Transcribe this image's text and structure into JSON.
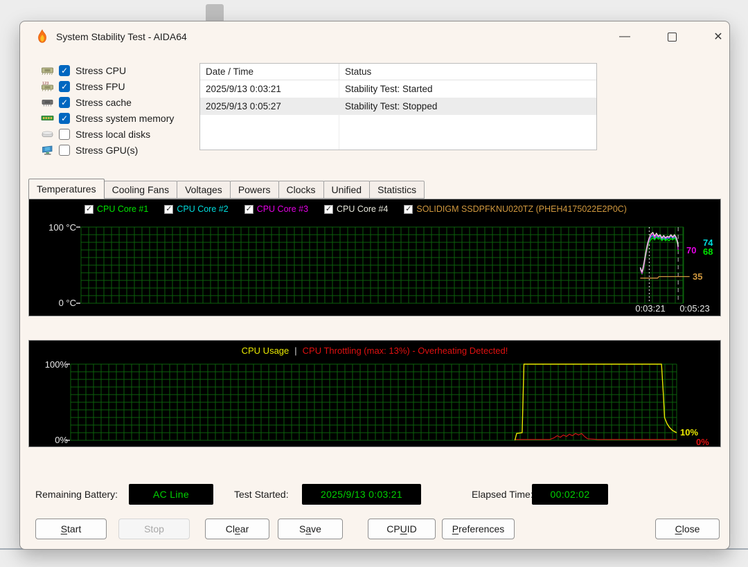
{
  "window": {
    "title": "System Stability Test - AIDA64",
    "controls": {
      "minimize": "—",
      "close": "✕"
    }
  },
  "stress_options": [
    {
      "label": "Stress CPU",
      "checked": true,
      "icon": "cpu-icon"
    },
    {
      "label": "Stress FPU",
      "checked": true,
      "icon": "fpu-icon"
    },
    {
      "label": "Stress cache",
      "checked": true,
      "icon": "cache-icon"
    },
    {
      "label": "Stress system memory",
      "checked": true,
      "icon": "memory-icon"
    },
    {
      "label": "Stress local disks",
      "checked": false,
      "icon": "disk-icon"
    },
    {
      "label": "Stress GPU(s)",
      "checked": false,
      "icon": "gpu-icon"
    }
  ],
  "log_table": {
    "columns": [
      "Date / Time",
      "Status"
    ],
    "rows": [
      {
        "datetime": "2025/9/13 0:03:21",
        "status": "Stability Test: Started",
        "selected": false
      },
      {
        "datetime": "2025/9/13 0:05:27",
        "status": "Stability Test: Stopped",
        "selected": true
      }
    ],
    "empty_row_count": 2
  },
  "tabs": [
    {
      "label": "Temperatures",
      "active": true
    },
    {
      "label": "Cooling Fans",
      "active": false
    },
    {
      "label": "Voltages",
      "active": false
    },
    {
      "label": "Powers",
      "active": false
    },
    {
      "label": "Clocks",
      "active": false
    },
    {
      "label": "Unified",
      "active": false
    },
    {
      "label": "Statistics",
      "active": false
    }
  ],
  "chart_data": [
    {
      "type": "line",
      "panel": "temperatures",
      "ymax": 100,
      "ylabel_top": "100 °C",
      "ylabel_bottom": "0 °C",
      "x_tick_start": "0:03:21",
      "x_tick_end": "0:05:23",
      "grid": "green mesh on black",
      "legend": [
        {
          "label": "CPU Core #1",
          "color": "#00e400",
          "checked": true
        },
        {
          "label": "CPU Core #2",
          "color": "#00dcdc",
          "checked": true
        },
        {
          "label": "CPU Core #3",
          "color": "#e400e4",
          "checked": true
        },
        {
          "label": "CPU Core #4",
          "color": "#e8e8dc",
          "checked": true
        },
        {
          "label": "SOLIDIGM SSDPFKNU020TZ (PHEH4175022E2P0C)",
          "color": "#d0983e",
          "checked": true
        }
      ],
      "end_labels": [
        {
          "text": "70",
          "color": "#e400e4"
        },
        {
          "text": "74",
          "color": "#00dcdc"
        },
        {
          "text": "68",
          "color": "#00e400"
        },
        {
          "text": "35",
          "color": "#d0983e"
        }
      ],
      "markers": {
        "test_start_x": 0.943,
        "test_end_x": 0.991
      },
      "series": [
        {
          "name": "CPU Core #4",
          "color": "#e8e8dc",
          "points": [
            [
              0.928,
              47
            ],
            [
              0.931,
              41
            ],
            [
              0.934,
              52
            ],
            [
              0.937,
              66
            ],
            [
              0.94,
              78
            ],
            [
              0.943,
              86
            ],
            [
              0.946,
              91
            ],
            [
              0.949,
              93
            ],
            [
              0.952,
              88
            ],
            [
              0.955,
              92
            ],
            [
              0.958,
              88
            ],
            [
              0.961,
              90
            ],
            [
              0.964,
              86
            ],
            [
              0.967,
              89
            ],
            [
              0.97,
              86
            ],
            [
              0.973,
              88
            ],
            [
              0.976,
              87
            ],
            [
              0.979,
              90
            ],
            [
              0.982,
              87
            ],
            [
              0.985,
              90
            ],
            [
              0.988,
              86
            ],
            [
              0.99,
              81
            ],
            [
              0.991,
              74
            ]
          ]
        },
        {
          "name": "CPU Core #3",
          "color": "#e400e4",
          "points": [
            [
              0.928,
              45
            ],
            [
              0.931,
              39
            ],
            [
              0.934,
              48
            ],
            [
              0.937,
              63
            ],
            [
              0.94,
              75
            ],
            [
              0.943,
              84
            ],
            [
              0.946,
              89
            ],
            [
              0.949,
              91
            ],
            [
              0.952,
              86
            ],
            [
              0.955,
              90
            ],
            [
              0.958,
              87
            ],
            [
              0.961,
              89
            ],
            [
              0.964,
              85
            ],
            [
              0.967,
              88
            ],
            [
              0.97,
              85
            ],
            [
              0.973,
              87
            ],
            [
              0.976,
              86
            ],
            [
              0.979,
              89
            ],
            [
              0.982,
              86
            ],
            [
              0.985,
              89
            ],
            [
              0.988,
              85
            ],
            [
              0.99,
              79
            ],
            [
              0.991,
              70
            ]
          ]
        },
        {
          "name": "CPU Core #2",
          "color": "#00dcdc",
          "points": [
            [
              0.928,
              46
            ],
            [
              0.931,
              40
            ],
            [
              0.934,
              50
            ],
            [
              0.937,
              64
            ],
            [
              0.94,
              76
            ],
            [
              0.943,
              83
            ],
            [
              0.946,
              87
            ],
            [
              0.949,
              89
            ],
            [
              0.952,
              85
            ],
            [
              0.955,
              89
            ],
            [
              0.958,
              86
            ],
            [
              0.961,
              88
            ],
            [
              0.964,
              84
            ],
            [
              0.967,
              87
            ],
            [
              0.97,
              84
            ],
            [
              0.973,
              86
            ],
            [
              0.976,
              85
            ],
            [
              0.979,
              88
            ],
            [
              0.982,
              85
            ],
            [
              0.985,
              88
            ],
            [
              0.988,
              84
            ],
            [
              0.99,
              80
            ],
            [
              0.991,
              74
            ]
          ]
        },
        {
          "name": "CPU Core #1",
          "color": "#00e400",
          "points": [
            [
              0.928,
              44
            ],
            [
              0.931,
              38
            ],
            [
              0.934,
              46
            ],
            [
              0.937,
              60
            ],
            [
              0.94,
              72
            ],
            [
              0.943,
              80
            ],
            [
              0.946,
              84
            ],
            [
              0.949,
              86
            ],
            [
              0.952,
              83
            ],
            [
              0.955,
              87
            ],
            [
              0.958,
              84
            ],
            [
              0.961,
              86
            ],
            [
              0.964,
              82
            ],
            [
              0.967,
              85
            ],
            [
              0.97,
              82
            ],
            [
              0.973,
              84
            ],
            [
              0.976,
              82
            ],
            [
              0.979,
              85
            ],
            [
              0.982,
              83
            ],
            [
              0.985,
              86
            ],
            [
              0.988,
              82
            ],
            [
              0.99,
              77
            ],
            [
              0.991,
              68
            ]
          ]
        },
        {
          "name": "SOLIDIGM SSD",
          "color": "#d0983e",
          "points": [
            [
              0.928,
              33
            ],
            [
              0.957,
              33
            ],
            [
              0.959,
              35
            ],
            [
              0.991,
              35
            ],
            [
              1.01,
              35
            ]
          ]
        }
      ]
    },
    {
      "type": "line",
      "panel": "cpu-usage",
      "ymax": 100,
      "title_left": "CPU Usage",
      "title_separator": "|",
      "title_right": "CPU Throttling (max: 13%) - Overheating Detected!",
      "ylabel_top": "100%",
      "ylabel_bottom": "0%",
      "throttling_max_percent": 13,
      "end_labels": [
        {
          "text": "10%",
          "color": "#e8e800"
        },
        {
          "text": "0%",
          "color": "#e01010"
        }
      ],
      "series": [
        {
          "name": "CPU Throttling",
          "color": "#cc1414",
          "points": [
            [
              0.733,
              1
            ],
            [
              0.79,
              1
            ],
            [
              0.797,
              3
            ],
            [
              0.803,
              6
            ],
            [
              0.808,
              4
            ],
            [
              0.813,
              7
            ],
            [
              0.818,
              5
            ],
            [
              0.823,
              8
            ],
            [
              0.828,
              6
            ],
            [
              0.833,
              9
            ],
            [
              0.838,
              7
            ],
            [
              0.843,
              9
            ],
            [
              0.848,
              5
            ],
            [
              0.853,
              2
            ],
            [
              0.87,
              1
            ],
            [
              1.0,
              1
            ]
          ]
        },
        {
          "name": "CPU Usage",
          "color": "#e8e800",
          "points": [
            [
              0.733,
              0
            ],
            [
              0.736,
              9
            ],
            [
              0.745,
              10
            ],
            [
              0.748,
              100
            ],
            [
              0.975,
              100
            ],
            [
              0.978,
              60
            ],
            [
              0.98,
              30
            ],
            [
              0.984,
              22
            ],
            [
              0.988,
              17
            ],
            [
              0.993,
              13
            ],
            [
              1.0,
              10
            ]
          ]
        }
      ]
    }
  ],
  "status_bar": {
    "battery_label": "Remaining Battery:",
    "battery_value": "AC Line",
    "test_started_label": "Test Started:",
    "test_started_value": "2025/9/13 0:03:21",
    "elapsed_label": "Elapsed Time:",
    "elapsed_value": "00:02:02",
    "value_color": "#00d200"
  },
  "buttons": [
    {
      "label": "Start",
      "underline": 0,
      "disabled": false
    },
    {
      "label": "Stop",
      "underline": -1,
      "disabled": true
    },
    {
      "label": "Clear",
      "underline": 2,
      "disabled": false
    },
    {
      "label": "Save",
      "underline": 1,
      "disabled": false
    },
    {
      "label": "CPUID",
      "underline": 2,
      "disabled": false
    },
    {
      "label": "Preferences",
      "underline": 0,
      "disabled": false
    },
    {
      "label": "Close",
      "underline": 0,
      "disabled": false
    }
  ]
}
